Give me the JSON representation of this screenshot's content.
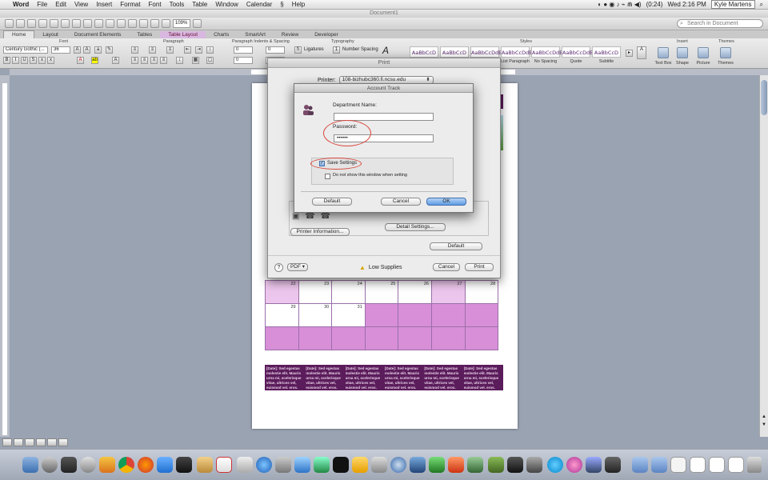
{
  "menubar": {
    "app": "Word",
    "items": [
      "File",
      "Edit",
      "View",
      "Insert",
      "Format",
      "Font",
      "Tools",
      "Table",
      "Window",
      "Calendar",
      "Help"
    ],
    "battery": "(0:24)",
    "clock": "Wed 2:16 PM",
    "user": "Kyle Martens"
  },
  "window": {
    "title": "Document1"
  },
  "toolbar": {
    "zoom": "109%",
    "search_placeholder": "Search in Document"
  },
  "ribbon": {
    "tabs": [
      "Home",
      "Layout",
      "Document Elements",
      "Tables",
      "Table Layout",
      "Charts",
      "SmartArt",
      "Review",
      "Developer"
    ],
    "groups": [
      "Font",
      "Paragraph",
      "Paragraph Indents & Spacing",
      "Typography",
      "Styles",
      "Insert",
      "Themes"
    ],
    "font_name": "Century Gothic (...",
    "font_size": "36",
    "indent_values": [
      "0",
      "0",
      "0",
      "0"
    ],
    "ligatures": "Ligatures",
    "number_spacing": "Number Spacing",
    "styles": [
      {
        "sample": "AaBbCcD",
        "label": ""
      },
      {
        "sample": "AaBbCcD",
        "label": ""
      },
      {
        "sample": "AaBbCcDdE",
        "label": ""
      },
      {
        "sample": "AaBbCcDdE",
        "label": "List Paragraph"
      },
      {
        "sample": "AaBbCcDdE",
        "label": "No Spacing"
      },
      {
        "sample": "AaBbCcDdE",
        "label": "Quote"
      },
      {
        "sample": "AaBbCcD",
        "label": "Subtitle"
      }
    ],
    "insert_items": [
      "Text Box",
      "Shape",
      "Picture"
    ],
    "themes_label": "Themes"
  },
  "document": {
    "calendar_rows": [
      [
        {
          "n": "22",
          "s": "light"
        },
        {
          "n": "23",
          "s": ""
        },
        {
          "n": "24",
          "s": ""
        },
        {
          "n": "25",
          "s": ""
        },
        {
          "n": "26",
          "s": ""
        },
        {
          "n": "27",
          "s": "light"
        },
        {
          "n": "28",
          "s": ""
        }
      ],
      [
        {
          "n": "29",
          "s": ""
        },
        {
          "n": "30",
          "s": ""
        },
        {
          "n": "31",
          "s": ""
        },
        {
          "n": "",
          "s": "dark"
        },
        {
          "n": "",
          "s": "dark"
        },
        {
          "n": "",
          "s": "dark"
        },
        {
          "n": "",
          "s": "dark"
        }
      ],
      [
        {
          "n": "",
          "s": "dark"
        },
        {
          "n": "",
          "s": "dark"
        },
        {
          "n": "",
          "s": "dark"
        },
        {
          "n": "",
          "s": "dark"
        },
        {
          "n": "",
          "s": "dark"
        },
        {
          "n": "",
          "s": "dark"
        },
        {
          "n": "",
          "s": "dark"
        }
      ]
    ],
    "footer_block": "[Date]: Sed egestas molestie elit. Mauris urna mi, scelerisque vitae, ultrices vel, euismod vel, eros."
  },
  "print_dialog": {
    "title": "Print",
    "printer_label": "Printer:",
    "printer_value": "108-bizhubc360.fi.ncsu.edu",
    "printer_info_button": "Printer Information...",
    "detail_settings_button": "Detail Settings...",
    "default_button": "Default",
    "help": "?",
    "pdf_button": "PDF ▾",
    "low_supplies": "Low Supplies",
    "cancel_button": "Cancel",
    "print_button": "Print"
  },
  "account_dialog": {
    "title": "Account Track",
    "department_label": "Department Name:",
    "department_value": "",
    "password_label": "Password:",
    "password_value": "••••••",
    "save_settings_label": "Save Settings",
    "save_settings_checked": true,
    "dont_show_label": "Do not show this window when setting",
    "dont_show_checked": false,
    "default_button": "Default",
    "cancel_button": "Cancel",
    "ok_button": "OK"
  },
  "colors": {
    "accent": "#5d9be3",
    "highlight": "#d9463c",
    "calendar_dark": "#d88fd8",
    "calendar_light": "#ecc6ec",
    "footer": "#5b1c5b"
  }
}
